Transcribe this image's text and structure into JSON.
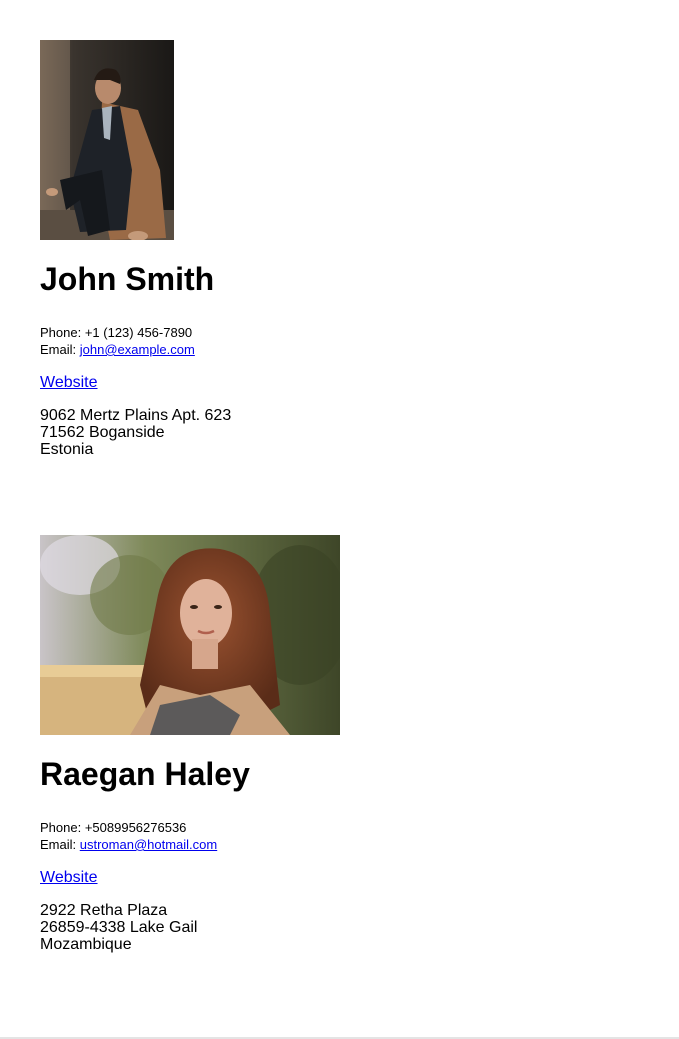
{
  "people": [
    {
      "photo_alt": "Portrait of John Smith",
      "name": "John Smith",
      "phone_label": "Phone:",
      "phone": "+1 (123) 456-7890",
      "email_label": "Email:",
      "email": "john@example.com",
      "website_label": "Website",
      "address_line1": "9062 Mertz Plains Apt. 623",
      "address_line2": "71562 Boganside",
      "address_line3": "Estonia"
    },
    {
      "photo_alt": "Portrait of Raegan Haley",
      "name": "Raegan Haley",
      "phone_label": "Phone:",
      "phone": "+5089956276536",
      "email_label": "Email:",
      "email": "ustroman@hotmail.com",
      "website_label": "Website",
      "address_line1": "2922 Retha Plaza",
      "address_line2": "26859-4338 Lake Gail",
      "address_line3": "Mozambique"
    }
  ],
  "colors": {
    "link": "#0000ee",
    "text": "#000000",
    "background": "#ffffff"
  }
}
